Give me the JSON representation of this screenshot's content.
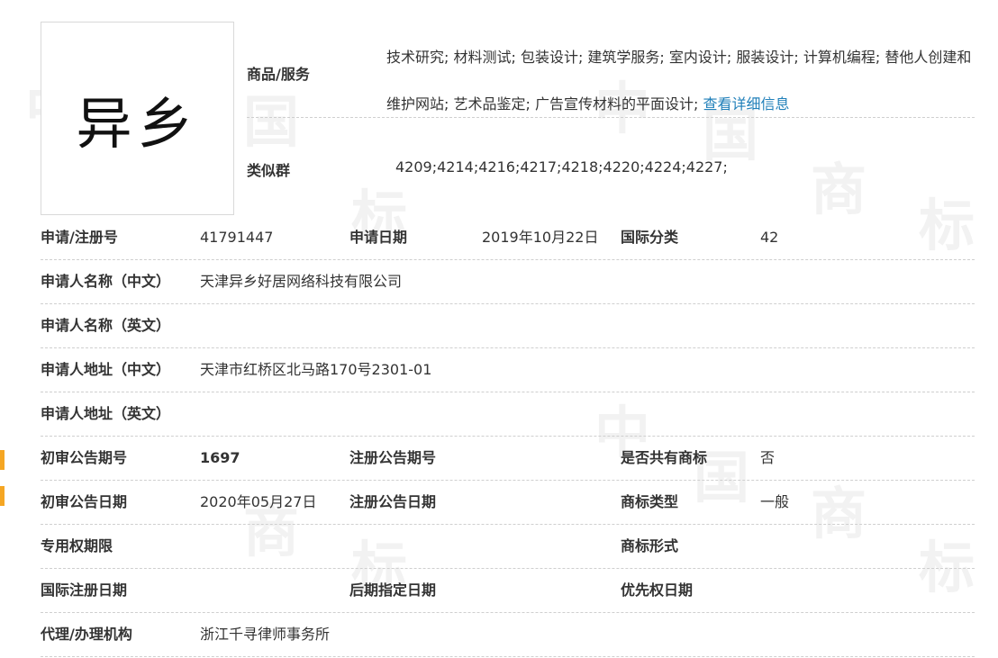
{
  "trademark": {
    "name": "异乡",
    "goods_label": "商品/服务",
    "goods_text": "技术研究; 材料测试; 包装设计; 建筑学服务; 室内设计; 服装设计; 计算机编程; 替他人创建和维护网站; 艺术品鉴定; 广告宣传材料的平面设计;",
    "goods_link": "查看详细信息",
    "similar_label": "类似群",
    "similar_value": "4209;4214;4216;4217;4218;4220;4224;4227;"
  },
  "watermark": {
    "chars": [
      "中",
      "国",
      "商",
      "标"
    ]
  },
  "rows": [
    {
      "l1": "申请/注册号",
      "v1": "41791447",
      "l2": "申请日期",
      "v2": "2019年10月22日",
      "l3": "国际分类",
      "v3": "42"
    },
    {
      "l1": "申请人名称（中文）",
      "v1": "天津异乡好居网络科技有限公司"
    },
    {
      "l1": "申请人名称（英文）",
      "v1": ""
    },
    {
      "l1": "申请人地址（中文）",
      "v1": "天津市红桥区北马路170号2301-01"
    },
    {
      "l1": "申请人地址（英文）",
      "v1": ""
    },
    {
      "l1": "初审公告期号",
      "v1": "1697",
      "l2": "注册公告期号",
      "v2": "",
      "l3": "是否共有商标",
      "v3": "否"
    },
    {
      "l1": "初审公告日期",
      "v1": "2020年05月27日",
      "l2": "注册公告日期",
      "v2": "",
      "l3": "商标类型",
      "v3": "一般"
    },
    {
      "l1": "专用权期限",
      "v1": "",
      "l3": "商标形式",
      "v3": ""
    },
    {
      "l1": "国际注册日期",
      "v1": "",
      "l2": "后期指定日期",
      "v2": "",
      "l3": "优先权日期",
      "v3": ""
    },
    {
      "l1": "代理/办理机构",
      "v1": "浙江千寻律师事务所"
    }
  ],
  "colors": {
    "link": "#1f7fb9",
    "edge_marker": "#f5a623",
    "watermark": "#f2f2f2"
  }
}
